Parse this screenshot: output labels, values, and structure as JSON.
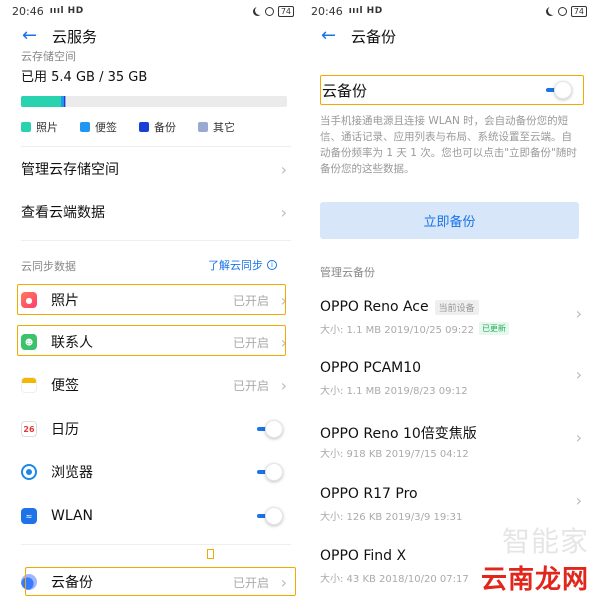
{
  "status_bar": {
    "time": "20:46",
    "network": "ıııl HD",
    "battery": "74"
  },
  "left": {
    "header": {
      "title": "云服务"
    },
    "storage": {
      "label": "云存储空间",
      "used_text": "已用 5.4 GB / 35 GB",
      "segments": [
        {
          "name": "照片",
          "fraction": 0.15,
          "color": "#2ad3b0"
        },
        {
          "name": "便签",
          "fraction": 0.01,
          "color": "#2196f3"
        },
        {
          "name": "备份",
          "fraction": 0.006,
          "color": "#1a3fd6"
        },
        {
          "name": "其它",
          "fraction": 0.002,
          "color": "#9aa8d4"
        }
      ],
      "legend": [
        {
          "label": "照片",
          "color": "#2ad3b0"
        },
        {
          "label": "便签",
          "color": "#2196f3"
        },
        {
          "label": "备份",
          "color": "#1a3fd6"
        },
        {
          "label": "其它",
          "color": "#9aa8d4"
        }
      ]
    },
    "menu": [
      {
        "label": "管理云存储空间"
      },
      {
        "label": "查看云端数据"
      }
    ],
    "sync_section": {
      "label": "云同步数据",
      "link": "了解云同步",
      "items": [
        {
          "label": "照片",
          "status": "已开启",
          "control": "chevron",
          "icon": "photos-icon",
          "color": "#ff5a5f",
          "highlight": true
        },
        {
          "label": "联系人",
          "status": "已开启",
          "control": "chevron",
          "icon": "contacts-icon",
          "color": "#3cc26a",
          "highlight": true
        },
        {
          "label": "便签",
          "status": "已开启",
          "control": "chevron",
          "icon": "notes-icon",
          "color": "#f5b800",
          "highlight": false
        },
        {
          "label": "日历",
          "status": "",
          "control": "toggle",
          "icon": "calendar-icon",
          "color": "#ffffff",
          "highlight": false,
          "icon_text": "26"
        },
        {
          "label": "浏览器",
          "status": "",
          "control": "toggle",
          "icon": "browser-icon",
          "color": "#1e88e5",
          "highlight": false
        },
        {
          "label": "WLAN",
          "status": "",
          "control": "toggle",
          "icon": "wifi-icon",
          "color": "#1e73e8",
          "highlight": false
        }
      ]
    },
    "cloud_backup": {
      "label": "云备份",
      "status": "已开启"
    }
  },
  "right": {
    "header": {
      "title": "云备份"
    },
    "toggle": {
      "label": "云备份",
      "on": true
    },
    "description": "当手机接通电源且连接 WLAN 时，会自动备份您的短信、通话记录、应用列表与布局、系统设置至云端。自动备份频率为 1 天 1 次。您也可以点击\"立即备份\"随时备份您的这些数据。",
    "backup_button": "立即备份",
    "manage_label": "管理云备份",
    "devices": [
      {
        "name": "OPPO Reno Ace",
        "badge": "当前设备",
        "meta": "大小: 1.1 MB  2019/10/25 09:22",
        "updated": "已更新"
      },
      {
        "name": "OPPO PCAM10",
        "badge": "",
        "meta": "大小: 1.1 MB  2019/8/23 09:12",
        "updated": ""
      },
      {
        "name": "OPPO Reno 10倍变焦版",
        "badge": "",
        "meta": "大小: 918 KB  2019/7/15 04:12",
        "updated": ""
      },
      {
        "name": "OPPO R17 Pro",
        "badge": "",
        "meta": "大小: 126 KB  2019/3/9 19:31",
        "updated": ""
      },
      {
        "name": "OPPO Find X",
        "badge": "",
        "meta": "大小: 43 KB  2018/10/20 07:17",
        "updated": ""
      }
    ],
    "watermark": {
      "faint": "智能家",
      "main": "云南龙网"
    }
  },
  "colors": {
    "accent": "#1a73e8",
    "highlight": "#f2a900",
    "button_bg": "#d7e6f8"
  }
}
